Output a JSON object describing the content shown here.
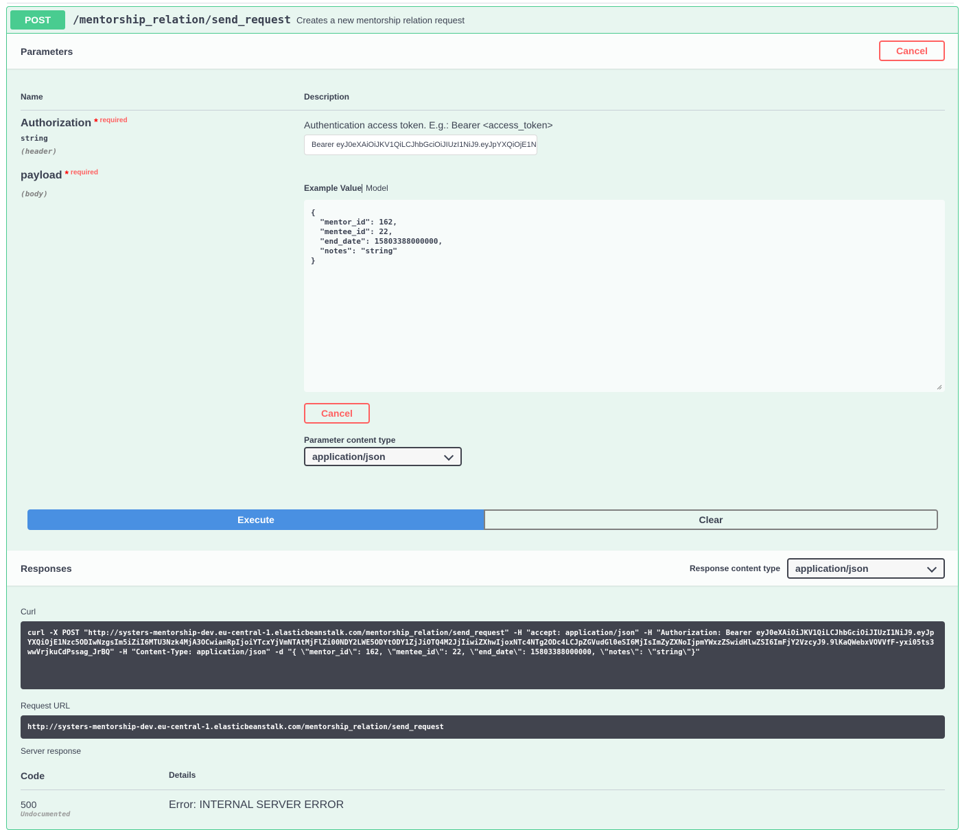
{
  "operation": {
    "method": "POST",
    "path": "/mentorship_relation/send_request",
    "summary": "Creates a new mentorship relation request"
  },
  "parameters_section": {
    "title": "Parameters",
    "cancel_label": "Cancel",
    "col_name": "Name",
    "col_description": "Description"
  },
  "params": [
    {
      "name": "Authorization",
      "required_star": "*",
      "required_label": "required",
      "type": "string",
      "in": "(header)",
      "description": "Authentication access token. E.g.: Bearer <access_token>",
      "value": "Bearer eyJ0eXAiOiJKV1QiLCJhbGciOiJIUzI1NiJ9.eyJpYXQiOjE1N"
    },
    {
      "name": "payload",
      "required_star": "*",
      "required_label": "required",
      "in": "(body)",
      "tab_example": "Example Value",
      "tab_model": "Model",
      "body": "{\n  \"mentor_id\": 162,\n  \"mentee_id\": 22,\n  \"end_date\": 15803388000000,\n  \"notes\": \"string\"\n}",
      "cancel_label": "Cancel",
      "content_type_label": "Parameter content type",
      "content_type_value": "application/json"
    }
  ],
  "actions": {
    "execute_label": "Execute",
    "clear_label": "Clear"
  },
  "responses_section": {
    "title": "Responses",
    "content_type_label": "Response content type",
    "content_type_value": "application/json",
    "curl_label": "Curl",
    "curl": "curl -X POST \"http://systers-mentorship-dev.eu-central-1.elasticbeanstalk.com/mentorship_relation/send_request\" -H \"accept: application/json\" -H \"Authorization: Bearer eyJ0eXAiOiJKV1QiLCJhbGciOiJIUzI1NiJ9.eyJpYXQiOjE1Nzc5ODIwNzgsIm5iZiI6MTU3Nzk4MjA3OCwianRpIjoiYTcxYjVmNTAtMjFlZi00NDY2LWE5ODYtODY1ZjJiOTQ4M2JjIiwiZXhwIjoxNTc4NTg2ODc4LCJpZGVudGl0eSI6MjIsImZyZXNoIjpmYWxzZSwidHlwZSI6ImFjY2VzcyJ9.9lKaQWebxVOVVfF-yxi05ts3wwVrjkuCdPssag_JrBQ\" -H \"Content-Type: application/json\" -d \"{ \\\"mentor_id\\\": 162, \\\"mentee_id\\\": 22, \\\"end_date\\\": 15803388000000, \\\"notes\\\": \\\"string\\\"}\"",
    "request_url_label": "Request URL",
    "request_url": "http://systers-mentorship-dev.eu-central-1.elasticbeanstalk.com/mentorship_relation/send_request",
    "server_response_label": "Server response",
    "col_code": "Code",
    "col_details": "Details",
    "code": "500",
    "code_note": "Undocumented",
    "details": "Error: INTERNAL SERVER ERROR"
  },
  "colors": {
    "post_green": "#49cc90",
    "execute_blue": "#4990e2",
    "cancel_red": "#ff6060",
    "code_bg": "#41444e"
  },
  "icons": {
    "select_arrow": "chevron-down-icon",
    "textarea_resize": "resize-grip-icon"
  }
}
